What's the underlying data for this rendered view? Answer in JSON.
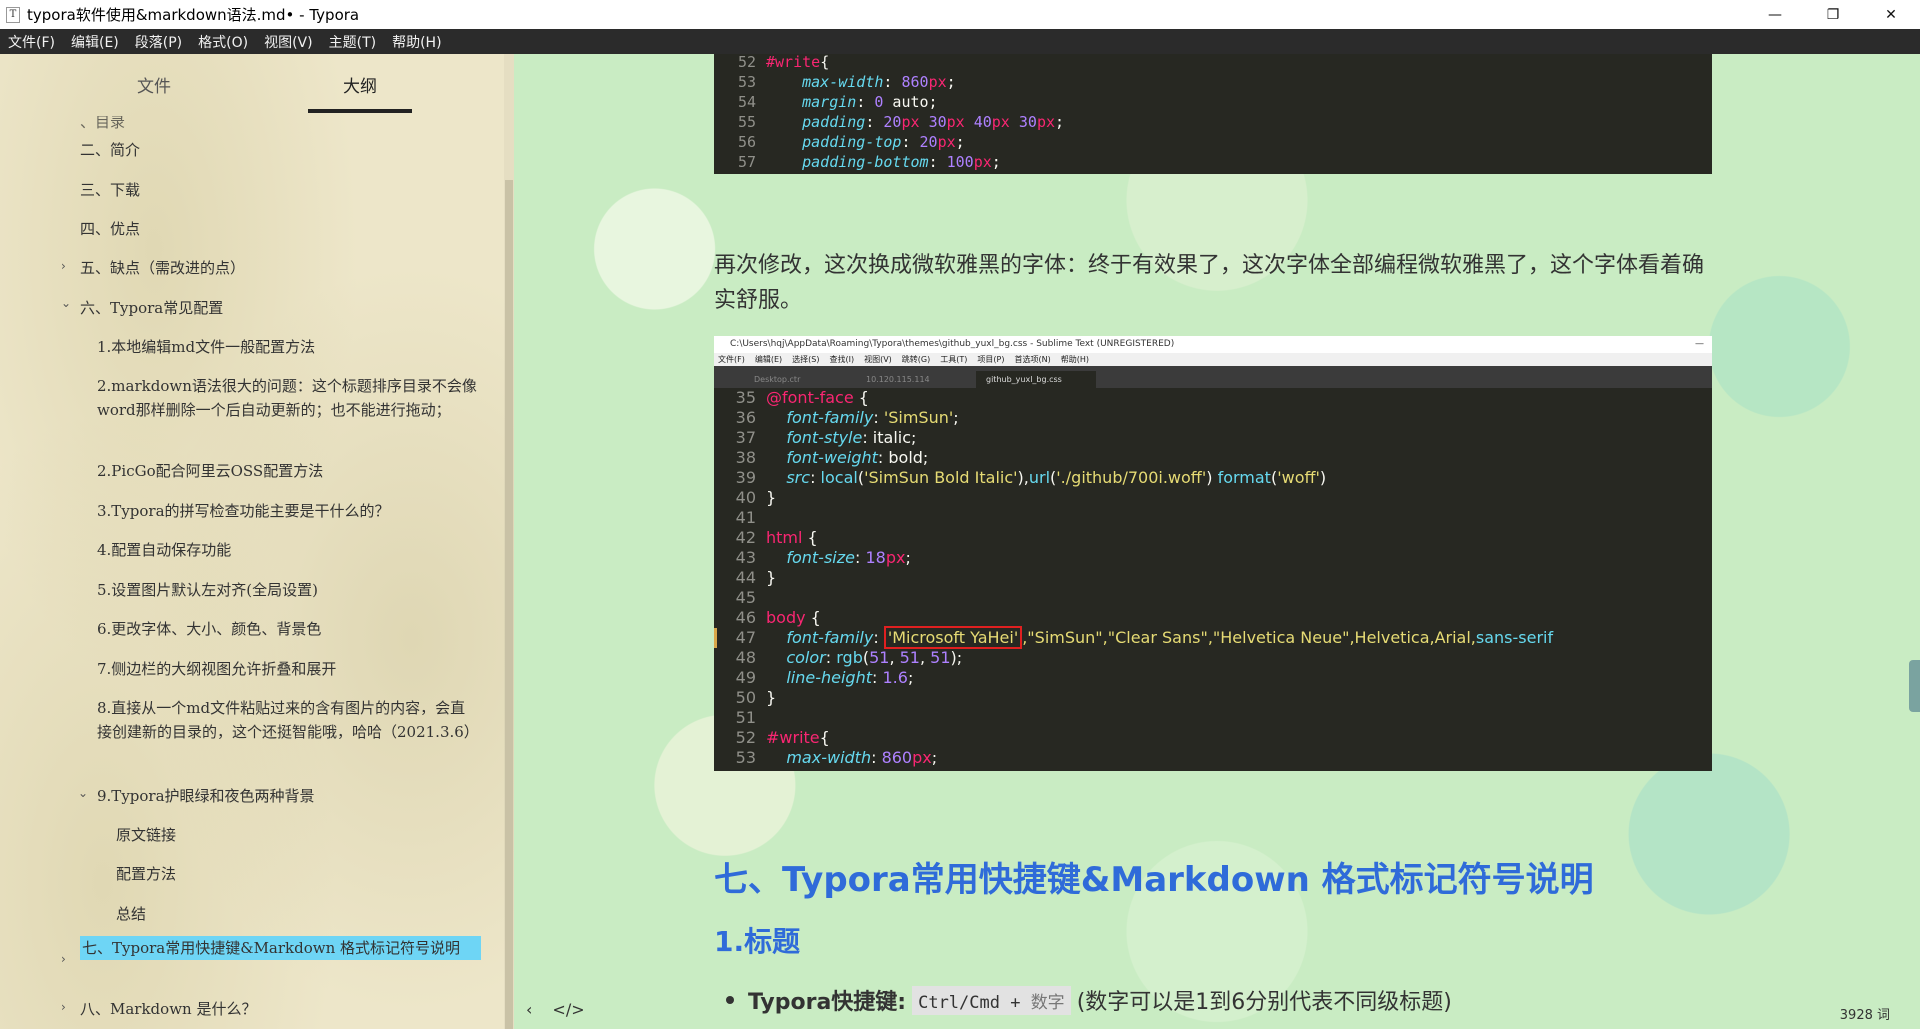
{
  "window": {
    "app_icon": "T",
    "title": "typora软件使用&markdown语法.md• - Typora",
    "minimize_icon": "—",
    "restore_icon": "❐",
    "close_icon": "✕"
  },
  "menu": [
    "文件(F)",
    "编辑(E)",
    "段落(P)",
    "格式(O)",
    "视图(V)",
    "主题(T)",
    "帮助(H)"
  ],
  "sidebar": {
    "tabs": [
      "文件",
      "大纲"
    ],
    "active_tab": "大纲",
    "outline": [
      {
        "text": "、目录",
        "arrow": ""
      },
      {
        "text": "二、简介",
        "arrow": ""
      },
      {
        "text": "三、下载",
        "arrow": ""
      },
      {
        "text": "四、优点",
        "arrow": ""
      },
      {
        "text": "五、缺点（需改进的点）",
        "arrow": "›"
      },
      {
        "text": "六、Typora常见配置",
        "arrow": "⌄"
      },
      {
        "text": "1.本地编辑md文件一般配置方法",
        "arrow": ""
      },
      {
        "text": "2.markdown语法很大的问题：这个标题排序目录不会像word那样删除一个后自动更新的；也不能进行拖动；",
        "arrow": ""
      },
      {
        "text": "2.PicGo配合阿里云OSS配置方法",
        "arrow": ""
      },
      {
        "text": "3.Typora的拼写检查功能主要是干什么的？",
        "arrow": ""
      },
      {
        "text": "4.配置自动保存功能",
        "arrow": ""
      },
      {
        "text": "5.设置图片默认左对齐(全局设置)",
        "arrow": ""
      },
      {
        "text": "6.更改字体、大小、颜色、背景色",
        "arrow": ""
      },
      {
        "text": "7.侧边栏的大纲视图允许折叠和展开",
        "arrow": ""
      },
      {
        "text": "8.直接从一个md文件粘贴过来的含有图片的内容，会直接创建新的目录的，这个还挺智能哦，哈哈（2021.3.6）",
        "arrow": ""
      },
      {
        "text": "9.Typora护眼绿和夜色两种背景",
        "arrow": "⌄"
      },
      {
        "text": "原文链接",
        "arrow": ""
      },
      {
        "text": "配置方法",
        "arrow": ""
      },
      {
        "text": "总结",
        "arrow": ""
      },
      {
        "text": "七、Typora常用快捷键&Markdown 格式标记符号说明",
        "arrow": "›"
      },
      {
        "text": "八、Markdown 是什么？",
        "arrow": "›"
      }
    ]
  },
  "top_code": {
    "lines": [
      {
        "n": "52",
        "parts": [
          [
            "k-sel",
            "#write"
          ],
          [
            "k-plain",
            "{"
          ]
        ]
      },
      {
        "n": "53",
        "parts": [
          [
            "k-plain",
            "    "
          ],
          [
            "k-prop",
            "max-width"
          ],
          [
            "k-plain",
            ": "
          ],
          [
            "k-num",
            "860"
          ],
          [
            "k-unit",
            "px"
          ],
          [
            "k-plain",
            ";"
          ]
        ]
      },
      {
        "n": "54",
        "parts": [
          [
            "k-plain",
            "    "
          ],
          [
            "k-prop",
            "margin"
          ],
          [
            "k-plain",
            ": "
          ],
          [
            "k-num",
            "0"
          ],
          [
            "k-plain",
            " auto;"
          ]
        ]
      },
      {
        "n": "55",
        "parts": [
          [
            "k-plain",
            "    "
          ],
          [
            "k-prop",
            "padding"
          ],
          [
            "k-plain",
            ": "
          ],
          [
            "k-num",
            "20"
          ],
          [
            "k-unit",
            "px"
          ],
          [
            "k-plain",
            " "
          ],
          [
            "k-num",
            "30"
          ],
          [
            "k-unit",
            "px"
          ],
          [
            "k-plain",
            " "
          ],
          [
            "k-num",
            "40"
          ],
          [
            "k-unit",
            "px"
          ],
          [
            "k-plain",
            " "
          ],
          [
            "k-num",
            "30"
          ],
          [
            "k-unit",
            "px"
          ],
          [
            "k-plain",
            ";"
          ]
        ]
      },
      {
        "n": "56",
        "parts": [
          [
            "k-plain",
            "    "
          ],
          [
            "k-prop",
            "padding-top"
          ],
          [
            "k-plain",
            ": "
          ],
          [
            "k-num",
            "20"
          ],
          [
            "k-unit",
            "px"
          ],
          [
            "k-plain",
            ";"
          ]
        ]
      },
      {
        "n": "57",
        "parts": [
          [
            "k-plain",
            "    "
          ],
          [
            "k-prop",
            "padding-bottom"
          ],
          [
            "k-plain",
            ": "
          ],
          [
            "k-num",
            "100"
          ],
          [
            "k-unit",
            "px"
          ],
          [
            "k-plain",
            ";"
          ]
        ]
      }
    ]
  },
  "paragraph": "再次修改，这次换成微软雅黑的字体：终于有效果了，这次字体全部编程微软雅黑了，这个字体看着确实舒服。",
  "screenshot": {
    "title": "C:\\Users\\hqj\\AppData\\Roaming\\Typora\\themes\\github_yuxl_bg.css - Sublime Text (UNREGISTERED)",
    "menu": [
      "文件(F)",
      "编辑(E)",
      "选择(S)",
      "查找(I)",
      "视图(V)",
      "跳转(G)",
      "工具(T)",
      "项目(P)",
      "首选项(N)",
      "帮助(H)"
    ],
    "tabs": [
      "Desktop.ctr",
      "10.120.115.114",
      "github_yuxl_bg.css"
    ],
    "lines": [
      {
        "n": "35",
        "parts": [
          [
            "k-sel",
            "@font-face"
          ],
          [
            "k-plain",
            " {"
          ]
        ]
      },
      {
        "n": "36",
        "parts": [
          [
            "k-plain",
            "    "
          ],
          [
            "k-prop",
            "font-family"
          ],
          [
            "k-plain",
            ": "
          ],
          [
            "k-str",
            "'SimSun'"
          ],
          [
            "k-plain",
            ";"
          ]
        ]
      },
      {
        "n": "37",
        "parts": [
          [
            "k-plain",
            "    "
          ],
          [
            "k-prop",
            "font-style"
          ],
          [
            "k-plain",
            ": italic;"
          ]
        ]
      },
      {
        "n": "38",
        "parts": [
          [
            "k-plain",
            "    "
          ],
          [
            "k-prop",
            "font-weight"
          ],
          [
            "k-plain",
            ": bold;"
          ]
        ]
      },
      {
        "n": "39",
        "parts": [
          [
            "k-plain",
            "    "
          ],
          [
            "k-prop",
            "src"
          ],
          [
            "k-plain",
            ": "
          ],
          [
            "k-fn",
            "local"
          ],
          [
            "k-plain",
            "("
          ],
          [
            "k-str",
            "'SimSun Bold Italic'"
          ],
          [
            "k-plain",
            "),"
          ],
          [
            "k-fn",
            "url"
          ],
          [
            "k-plain",
            "("
          ],
          [
            "k-str",
            "'./github/700i.woff'"
          ],
          [
            "k-plain",
            ") "
          ],
          [
            "k-fn",
            "format"
          ],
          [
            "k-plain",
            "("
          ],
          [
            "k-str",
            "'woff'"
          ],
          [
            "k-plain",
            ")"
          ]
        ]
      },
      {
        "n": "40",
        "parts": [
          [
            "k-plain",
            "}"
          ]
        ]
      },
      {
        "n": "41",
        "parts": []
      },
      {
        "n": "42",
        "parts": [
          [
            "k-sel",
            "html"
          ],
          [
            "k-plain",
            " {"
          ]
        ]
      },
      {
        "n": "43",
        "parts": [
          [
            "k-plain",
            "    "
          ],
          [
            "k-prop",
            "font-size"
          ],
          [
            "k-plain",
            ": "
          ],
          [
            "k-num",
            "18"
          ],
          [
            "k-unit",
            "px"
          ],
          [
            "k-plain",
            ";"
          ]
        ]
      },
      {
        "n": "44",
        "parts": [
          [
            "k-plain",
            "}"
          ]
        ]
      },
      {
        "n": "45",
        "parts": []
      },
      {
        "n": "46",
        "parts": [
          [
            "k-sel",
            "body"
          ],
          [
            "k-plain",
            " {"
          ]
        ]
      },
      {
        "n": "47",
        "parts": [
          [
            "k-plain",
            "    "
          ],
          [
            "k-prop",
            "font-family"
          ],
          [
            "k-plain",
            ": "
          ],
          [
            "hl",
            "'Microsoft YaHei'"
          ],
          [
            "k-str",
            ",\"SimSun\",\"Clear Sans\",\"Helvetica Neue\",Helvetica,Arial,"
          ],
          [
            "k-fn",
            "sans-serif"
          ]
        ]
      },
      {
        "n": "48",
        "parts": [
          [
            "k-plain",
            "    "
          ],
          [
            "k-prop",
            "color"
          ],
          [
            "k-plain",
            ": "
          ],
          [
            "k-fn",
            "rgb"
          ],
          [
            "k-plain",
            "("
          ],
          [
            "k-num",
            "51"
          ],
          [
            "k-plain",
            ", "
          ],
          [
            "k-num",
            "51"
          ],
          [
            "k-plain",
            ", "
          ],
          [
            "k-num",
            "51"
          ],
          [
            "k-plain",
            ");"
          ]
        ]
      },
      {
        "n": "49",
        "parts": [
          [
            "k-plain",
            "    "
          ],
          [
            "k-prop",
            "line-height"
          ],
          [
            "k-plain",
            ": "
          ],
          [
            "k-num",
            "1.6"
          ],
          [
            "k-plain",
            ";"
          ]
        ]
      },
      {
        "n": "50",
        "parts": [
          [
            "k-plain",
            "}"
          ]
        ]
      },
      {
        "n": "51",
        "parts": []
      },
      {
        "n": "52",
        "parts": [
          [
            "k-sel",
            "#write"
          ],
          [
            "k-plain",
            "{"
          ]
        ]
      },
      {
        "n": "53",
        "parts": [
          [
            "k-plain",
            "    "
          ],
          [
            "k-prop",
            "max-width"
          ],
          [
            "k-plain",
            ": "
          ],
          [
            "k-num",
            "860"
          ],
          [
            "k-unit",
            "px"
          ],
          [
            "k-plain",
            ";"
          ]
        ]
      }
    ]
  },
  "heading2": "七、Typora常用快捷键&Markdown 格式标记符号说明",
  "heading3": "1.标题",
  "bullet": {
    "label": "Typora快捷键:",
    "kbd": "Ctrl/Cmd + ",
    "kbd_gray": "数字",
    "rest": "(数字可以是1到6分别代表不同级标题)"
  },
  "status": {
    "back_icon": "‹",
    "source_icon": "</>",
    "word_count": "3928 词"
  },
  "colors": {
    "heading": "#2f6bd9",
    "active_outline": "#6ed5f5",
    "code_bg": "#272822",
    "highlight_box": "#e02020"
  }
}
